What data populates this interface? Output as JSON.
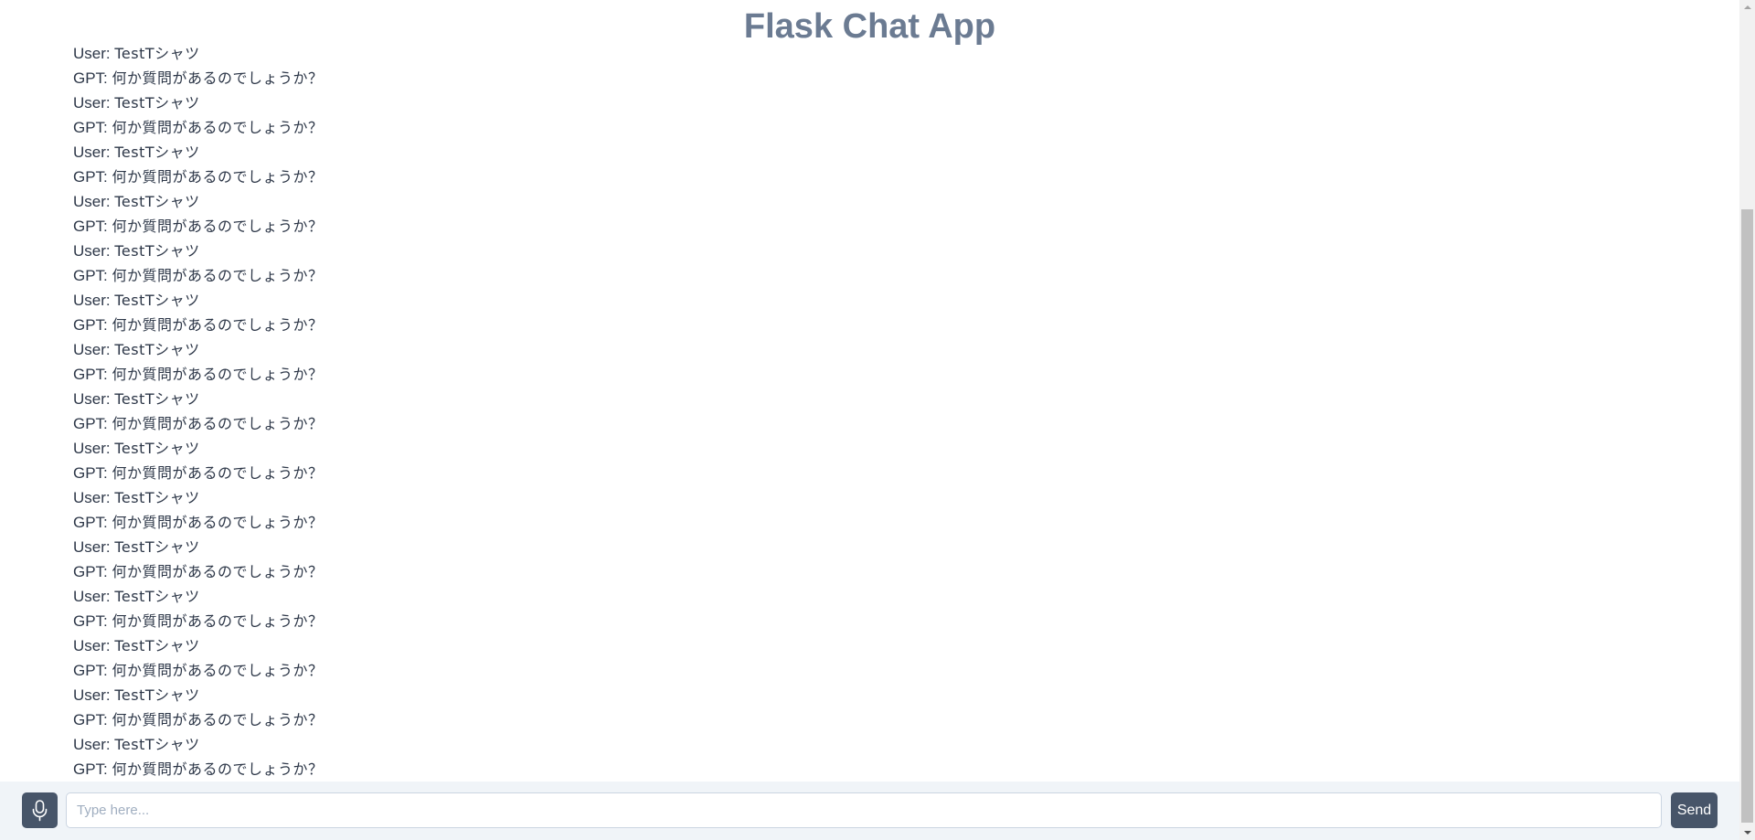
{
  "app": {
    "title": "Flask Chat App"
  },
  "messages": [
    {
      "speaker": "User: ",
      "text": "TestTシャツ"
    },
    {
      "speaker": "GPT: ",
      "text": "何か質問があるのでしょうか？"
    },
    {
      "speaker": "User: ",
      "text": "TestTシャツ"
    },
    {
      "speaker": "GPT: ",
      "text": "何か質問があるのでしょうか？"
    },
    {
      "speaker": "User: ",
      "text": "TestTシャツ"
    },
    {
      "speaker": "GPT: ",
      "text": "何か質問があるのでしょうか？"
    },
    {
      "speaker": "User: ",
      "text": "TestTシャツ"
    },
    {
      "speaker": "GPT: ",
      "text": "何か質問があるのでしょうか？"
    },
    {
      "speaker": "User: ",
      "text": "TestTシャツ"
    },
    {
      "speaker": "GPT: ",
      "text": "何か質問があるのでしょうか？"
    },
    {
      "speaker": "User: ",
      "text": "TestTシャツ"
    },
    {
      "speaker": "GPT: ",
      "text": "何か質問があるのでしょうか？"
    },
    {
      "speaker": "User: ",
      "text": "TestTシャツ"
    },
    {
      "speaker": "GPT: ",
      "text": "何か質問があるのでしょうか？"
    },
    {
      "speaker": "User: ",
      "text": "TestTシャツ"
    },
    {
      "speaker": "GPT: ",
      "text": "何か質問があるのでしょうか？"
    },
    {
      "speaker": "User: ",
      "text": "TestTシャツ"
    },
    {
      "speaker": "GPT: ",
      "text": "何か質問があるのでしょうか？"
    },
    {
      "speaker": "User: ",
      "text": "TestTシャツ"
    },
    {
      "speaker": "GPT: ",
      "text": "何か質問があるのでしょうか？"
    },
    {
      "speaker": "User: ",
      "text": "TestTシャツ"
    },
    {
      "speaker": "GPT: ",
      "text": "何か質問があるのでしょうか？"
    },
    {
      "speaker": "User: ",
      "text": "TestTシャツ"
    },
    {
      "speaker": "GPT: ",
      "text": "何か質問があるのでしょうか？"
    },
    {
      "speaker": "User: ",
      "text": "TestTシャツ"
    },
    {
      "speaker": "GPT: ",
      "text": "何か質問があるのでしょうか？"
    },
    {
      "speaker": "User: ",
      "text": "TestTシャツ"
    },
    {
      "speaker": "GPT: ",
      "text": "何か質問があるのでしょうか？"
    },
    {
      "speaker": "User: ",
      "text": "TestTシャツ"
    },
    {
      "speaker": "GPT: ",
      "text": "何か質問があるのでしょうか？"
    }
  ],
  "composer": {
    "mic_icon": "microphone-icon",
    "input_placeholder": "Type here...",
    "input_value": "",
    "send_label": "Send"
  },
  "colors": {
    "title": "#6b7b92",
    "message_text": "#2d3748",
    "composer_background": "#f0f4f8",
    "button_background": "#475569",
    "button_text": "#ffffff",
    "placeholder": "#a0aec0"
  }
}
